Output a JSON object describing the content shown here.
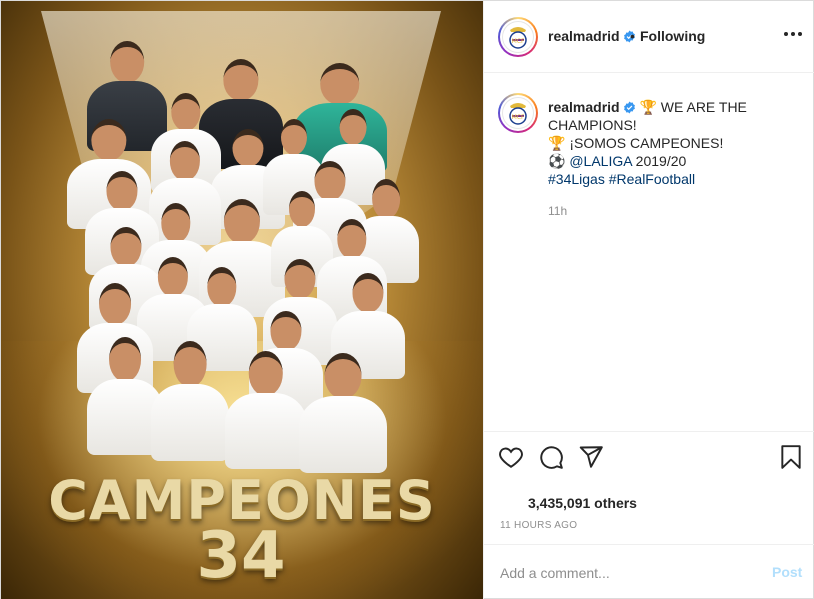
{
  "account": {
    "username": "realmadrid",
    "following_label": "Following",
    "separator": "•"
  },
  "caption": {
    "username": "realmadrid",
    "line1": "🏆 WE ARE THE CHAMPIONS!",
    "line2": "🏆 ¡SOMOS CAMPEONES!",
    "line3_prefix": "⚽ ",
    "mention": "@LALIGA",
    "line3_suffix": " 2019/20",
    "hashtag1": "#34Ligas",
    "hashtag2": "#RealFootball",
    "time": "11h"
  },
  "media": {
    "headline": "CAMPEONES",
    "number": "34"
  },
  "stats": {
    "likes": "3,435,091 others",
    "posted_ago": "11 HOURS AGO"
  },
  "comment": {
    "placeholder": "Add a comment...",
    "post_label": "Post"
  },
  "colors": {
    "verified": "#3897f0",
    "link": "#00376b",
    "post_disabled": "#b2dffc"
  },
  "icons": {
    "more": "more-options-icon",
    "like": "heart-icon",
    "comment": "comment-icon",
    "share": "share-icon",
    "save": "bookmark-icon"
  }
}
